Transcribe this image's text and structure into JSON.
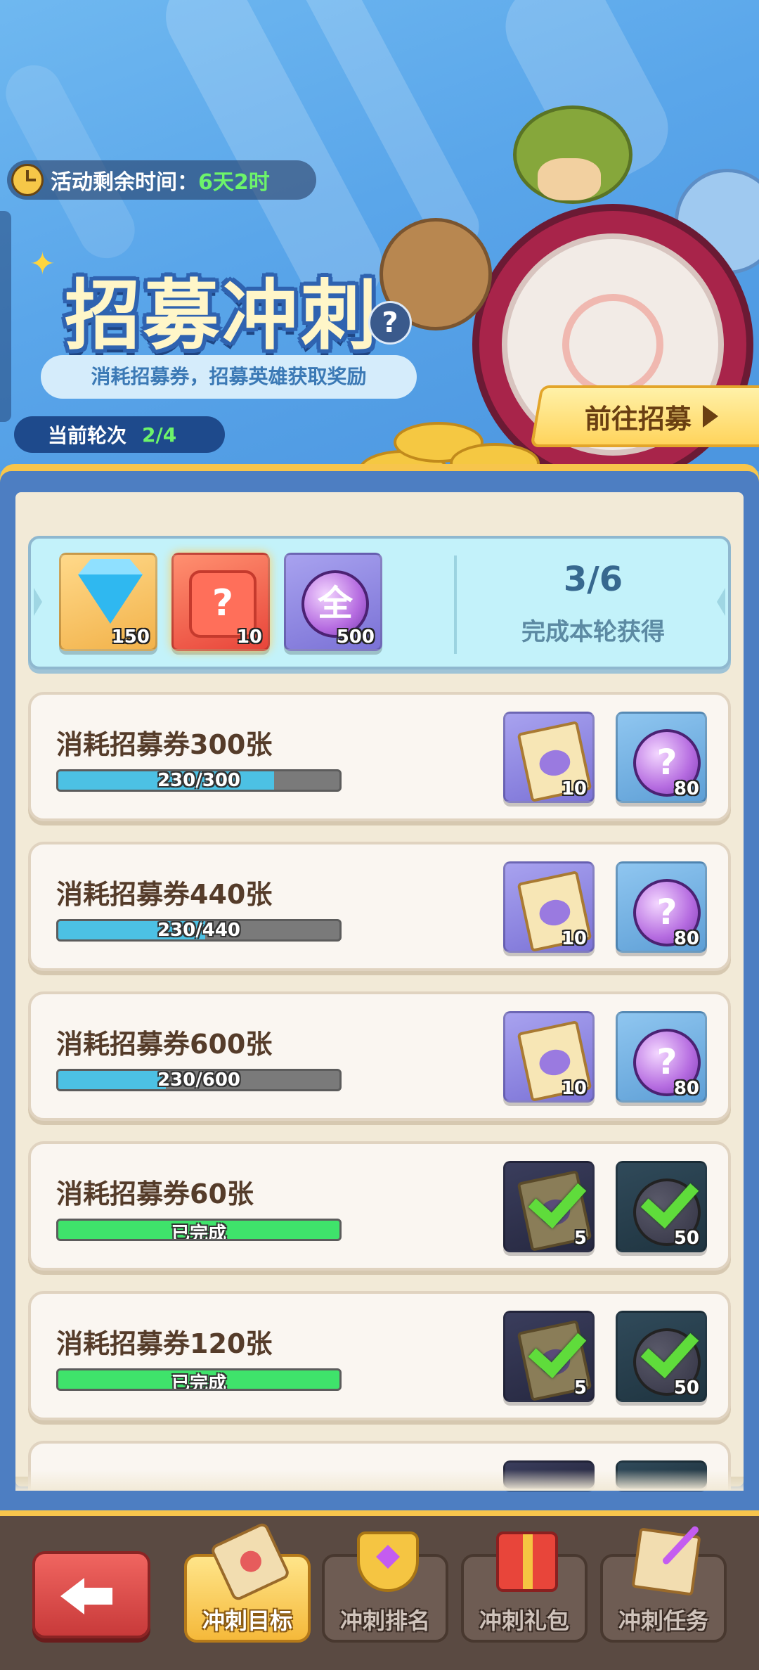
{
  "header": {
    "timer_label": "活动剩余时间：",
    "timer_value": "6天2时",
    "title": "招募冲刺",
    "help": "?",
    "subtitle": "消耗招募券，招募英雄获取奖励",
    "round_label": "当前轮次",
    "round_value": "2/4",
    "go_button": "前往招募"
  },
  "round_rewards": {
    "items": [
      {
        "icon": "diamond-icon",
        "count": "150"
      },
      {
        "icon": "mystery-puzzle-icon",
        "count": "10"
      },
      {
        "icon": "all-orb-icon",
        "glyph": "全",
        "count": "500"
      }
    ],
    "progress": "3/6",
    "caption": "完成本轮获得"
  },
  "tasks": [
    {
      "title": "消耗招募券300张",
      "current": 230,
      "target": 300,
      "bar_text": "230/300",
      "done": false,
      "rewards": [
        {
          "icon": "integral-scroll-icon",
          "count": "10"
        },
        {
          "icon": "mystery-orb-icon",
          "count": "80"
        }
      ]
    },
    {
      "title": "消耗招募券440张",
      "current": 230,
      "target": 440,
      "bar_text": "230/440",
      "done": false,
      "rewards": [
        {
          "icon": "integral-scroll-icon",
          "count": "10"
        },
        {
          "icon": "mystery-orb-icon",
          "count": "80"
        }
      ]
    },
    {
      "title": "消耗招募券600张",
      "current": 230,
      "target": 600,
      "bar_text": "230/600",
      "done": false,
      "rewards": [
        {
          "icon": "integral-scroll-icon",
          "count": "10"
        },
        {
          "icon": "mystery-orb-icon",
          "count": "80"
        }
      ]
    },
    {
      "title": "消耗招募券60张",
      "bar_text": "已完成",
      "done": true,
      "rewards": [
        {
          "icon": "integral-scroll-icon",
          "count": "5"
        },
        {
          "icon": "mystery-orb-icon",
          "count": "50"
        }
      ]
    },
    {
      "title": "消耗招募券120张",
      "bar_text": "已完成",
      "done": true,
      "rewards": [
        {
          "icon": "integral-scroll-icon",
          "count": "5"
        },
        {
          "icon": "mystery-orb-icon",
          "count": "50"
        }
      ]
    }
  ],
  "nav": {
    "tabs": [
      {
        "label": "冲刺目标",
        "icon": "scroll-icon",
        "active": true
      },
      {
        "label": "冲刺排名",
        "icon": "trophy-icon",
        "active": false
      },
      {
        "label": "冲刺礼包",
        "icon": "gift-chest-icon",
        "active": false
      },
      {
        "label": "冲刺任务",
        "icon": "quest-letter-icon",
        "active": false
      }
    ]
  },
  "colors": {
    "accent_gold": "#f7c54c",
    "progress_blue": "#4cc1e4",
    "done_green": "#3fe36b",
    "highlight_green": "#6df46a"
  }
}
